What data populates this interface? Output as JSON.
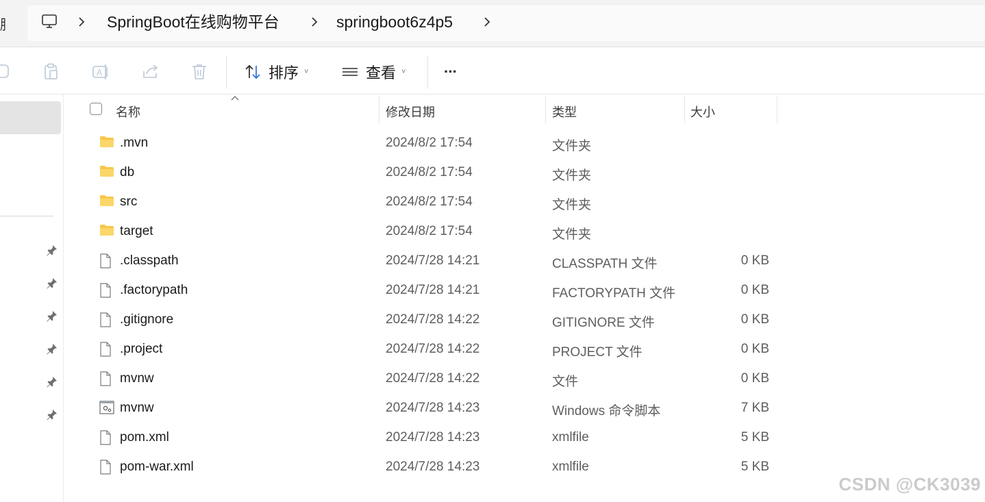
{
  "address_bar": {
    "left_cut_glyph": "脂",
    "crumbs": [
      "SpringBoot在线购物平台",
      "springboot6z4p5"
    ]
  },
  "toolbar": {
    "sort_label": "排序",
    "view_label": "查看",
    "more_label": "···"
  },
  "columns": {
    "name": "名称",
    "date": "修改日期",
    "type": "类型",
    "size": "大小"
  },
  "files": [
    {
      "name": ".mvn",
      "date": "2024/8/2 17:54",
      "type": "文件夹",
      "size": "",
      "icon": "folder-icon"
    },
    {
      "name": "db",
      "date": "2024/8/2 17:54",
      "type": "文件夹",
      "size": "",
      "icon": "folder-icon"
    },
    {
      "name": "src",
      "date": "2024/8/2 17:54",
      "type": "文件夹",
      "size": "",
      "icon": "folder-icon"
    },
    {
      "name": "target",
      "date": "2024/8/2 17:54",
      "type": "文件夹",
      "size": "",
      "icon": "folder-icon"
    },
    {
      "name": ".classpath",
      "date": "2024/7/28 14:21",
      "type": "CLASSPATH 文件",
      "size": "0 KB",
      "icon": "file-icon"
    },
    {
      "name": ".factorypath",
      "date": "2024/7/28 14:21",
      "type": "FACTORYPATH 文件",
      "size": "0 KB",
      "icon": "file-icon"
    },
    {
      "name": ".gitignore",
      "date": "2024/7/28 14:22",
      "type": "GITIGNORE 文件",
      "size": "0 KB",
      "icon": "file-icon"
    },
    {
      "name": ".project",
      "date": "2024/7/28 14:22",
      "type": "PROJECT 文件",
      "size": "0 KB",
      "icon": "file-icon"
    },
    {
      "name": "mvnw",
      "date": "2024/7/28 14:22",
      "type": "文件",
      "size": "0 KB",
      "icon": "file-icon"
    },
    {
      "name": "mvnw",
      "date": "2024/7/28 14:23",
      "type": "Windows 命令脚本",
      "size": "7 KB",
      "icon": "script-icon"
    },
    {
      "name": "pom.xml",
      "date": "2024/7/28 14:23",
      "type": "xmlfile",
      "size": "5 KB",
      "icon": "file-icon"
    },
    {
      "name": "pom-war.xml",
      "date": "2024/7/28 14:23",
      "type": "xmlfile",
      "size": "5 KB",
      "icon": "file-icon"
    }
  ],
  "watermark": "CSDN @CK3039",
  "colors": {
    "folder": "#f8c74a",
    "selection": "#e4e4e4",
    "secondary_text": "#5e5e5e"
  }
}
